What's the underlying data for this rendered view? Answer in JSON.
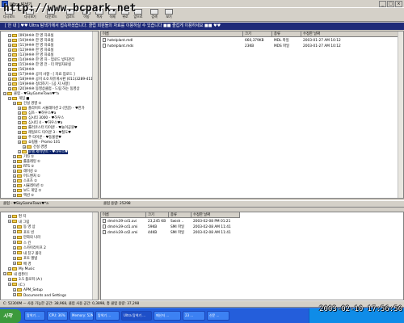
{
  "window": {
    "title": "Ultra 탐색기",
    "min": "_",
    "max": "□",
    "close": "×"
  },
  "watermark": "http://www.bcpark.net",
  "toolbar": {
    "items": [
      {
        "label": "다시로드",
        "icon": "reload-icon"
      },
      {
        "label": "다시보기",
        "icon": "view-icon"
      },
      {
        "label": "다운로드",
        "icon": "download-icon"
      },
      {
        "label": "업로드",
        "icon": "upload-icon"
      },
      {
        "label": "이동",
        "icon": "move-icon"
      },
      {
        "label": "복사",
        "icon": "copy-icon"
      },
      {
        "label": "삭제",
        "icon": "delete-icon"
      },
      {
        "label": "위로",
        "icon": "up-icon"
      },
      {
        "label": "앞으로",
        "icon": "forward-icon"
      },
      {
        "label": "검색",
        "icon": "search-icon"
      },
      {
        "label": "보기",
        "icon": "view-mode-icon"
      }
    ]
  },
  "banner": "[ 안 내 ] ♥♥ Ultra 탐색기에서 접속하셨습니다. 클럽 회원들의 자료를 이용하실 수 있습니다 ■■ 즐겁게 이용하세요 ■■ ♥♥",
  "top_tree": {
    "nodes": [
      {
        "label": "[09]※※※ 한 영 자료실",
        "depth": 1
      },
      {
        "label": "[10]※※※ 한 영 자료실",
        "depth": 1
      },
      {
        "label": "[11]※※※ 한 영 자료실",
        "depth": 1
      },
      {
        "label": "[12]※※※ 한 영 자료실",
        "depth": 1
      },
      {
        "label": "[13]※※※ 한 영 자료실",
        "depth": 1
      },
      {
        "label": "[14]※※※ 한 영 자 - 업로드 방지관리",
        "depth": 1
      },
      {
        "label": "[15]※※※ 한 영 전 - 더 파일자료실",
        "depth": 1
      },
      {
        "label": "[16]※※※",
        "depth": 1
      },
      {
        "label": "[17]※※※ 공지 사항 - [ 자료 업로드 ]",
        "depth": 1
      },
      {
        "label": "[18]※※※ 공지 4.0 자유게시판 (011)3289-4115",
        "depth": 1
      },
      {
        "label": "[19]※※※ 정리하기 - [공 지 사항]",
        "depth": 1
      },
      {
        "label": "[20]※※※ 동영상클럽 - 드림 하는 동영상",
        "depth": 1
      },
      {
        "label": "클럽 - ♥SkyGameTown♥*a",
        "depth": 0
      },
      {
        "label": "게임 ■",
        "depth": 1
      },
      {
        "label": "건설 경영 ①",
        "depth": 2
      },
      {
        "label": "플라이트 시뮬레이션 2 (한글) - ♥한가",
        "depth": 3
      },
      {
        "label": "심즈 - ♥하우스♥a",
        "depth": 3
      },
      {
        "label": "심시티 3000 - ♥하우스",
        "depth": 3
      },
      {
        "label": "심시티 4 - ♥하우스♥a",
        "depth": 3
      },
      {
        "label": "롤러코스터 타이쿤 - ♥놀이공원♥",
        "depth": 3
      },
      {
        "label": "레일로드 타이쿤 3 - ♥철도♥",
        "depth": 3
      },
      {
        "label": "주 타이쿤 - ♥동물원♥",
        "depth": 3
      },
      {
        "label": "쇼핑몰 - Promo 101",
        "depth": 3
      },
      {
        "label": "건설 경영",
        "depth": 4
      },
      {
        "label": "호텔 제이먼트 - ♥하우스♥",
        "depth": 3,
        "selected": true
      },
      {
        "label": "기타 ①",
        "depth": 2
      },
      {
        "label": "롤플레잉 ①",
        "depth": 2
      },
      {
        "label": "RTS ①",
        "depth": 2
      },
      {
        "label": "레이싱 ①",
        "depth": 2
      },
      {
        "label": "어드벤처 ①",
        "depth": 2
      },
      {
        "label": "스포츠 ①",
        "depth": 2
      },
      {
        "label": "시뮬레이션 ①",
        "depth": 2
      },
      {
        "label": "보드 게임 ①",
        "depth": 2
      },
      {
        "label": "액션 ①",
        "depth": 2
      }
    ]
  },
  "top_list": {
    "columns": [
      "이름",
      "크기",
      "종류",
      "수정한 날짜"
    ],
    "rows": [
      {
        "name": "hotelplant.mdl",
        "size": "660,379KB",
        "type": "MDL 파일",
        "date": "2003-01-27 AM 10:12"
      },
      {
        "name": "hotelplant.mds",
        "size": "23KB",
        "type": "MDS 파일",
        "date": "2003-01-27 AM 10:12"
      }
    ]
  },
  "mid_strip": {
    "club": "클럽 - ♥SkyGameTown♥*a",
    "usage": "클럽 용량: 25298"
  },
  "bottom_tree": {
    "nodes": [
      {
        "label": "편 지",
        "depth": 1
      },
      {
        "label": "내 그림",
        "depth": 1
      },
      {
        "label": "동 영 상",
        "depth": 2
      },
      {
        "label": "포토 빈",
        "depth": 2
      },
      {
        "label": "만화의 나라",
        "depth": 2
      },
      {
        "label": "스 킨",
        "depth": 2
      },
      {
        "label": "스카이라이프 2",
        "depth": 2
      },
      {
        "label": "내 친구 폴더",
        "depth": 2
      },
      {
        "label": "포토 앨범",
        "depth": 2
      },
      {
        "label": "배 경",
        "depth": 2
      },
      {
        "label": "My Music",
        "depth": 1
      },
      {
        "label": "내 컴퓨터",
        "depth": 0
      },
      {
        "label": "3.5 플로피 (A:)",
        "depth": 1
      },
      {
        "label": "(C:)",
        "depth": 1
      },
      {
        "label": "APM_Setup",
        "depth": 2
      },
      {
        "label": "Documents and Settings",
        "depth": 2
      }
    ]
  },
  "bottom_list": {
    "columns": [
      "이름",
      "크기",
      "종류",
      "수정한 날짜"
    ],
    "rows": [
      {
        "name": "dmd-k39-cd1.avi",
        "size": "23,245 KB",
        "type": "Swish ..",
        "date": "2003-02-08 PM 01:21"
      },
      {
        "name": "dmd-k39-cd1.smi",
        "size": "59KB",
        "type": "SMI 파일",
        "date": "2003-02-08 AM 11:41"
      },
      {
        "name": "dmd-k39-cd2.smi",
        "size": "44KB",
        "type": "SMI 파일",
        "date": "2003-02-08 AM 11:41"
      }
    ]
  },
  "status": "C: 52300M ㅡ 사용 가능한 공간: 38,968, 클럽 사용 공간: 0,3898, 총 클럽 용량: 37,298",
  "taskbar": {
    "start": "시작",
    "tasks": [
      "탐색기 ...",
      "CPU: 36%",
      "Memory: 52MB",
      "탐색기 ...",
      "Ultra 탐색기 ...",
      "메신저 ...",
      "23 ...",
      "신문 ..."
    ]
  },
  "clock": "2003-02-10 17:56:50"
}
